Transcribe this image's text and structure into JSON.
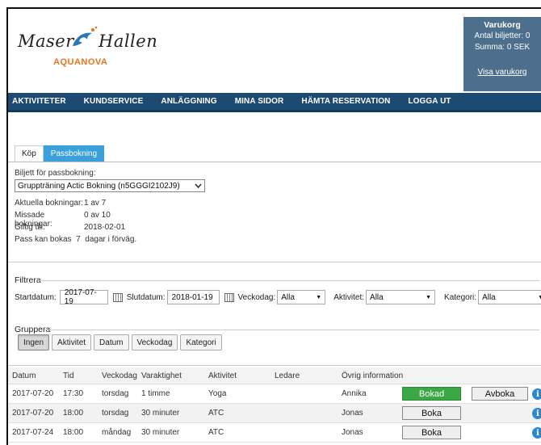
{
  "header": {
    "logo_word1": "Maser",
    "logo_word2": "Hallen",
    "logo_sub": "AQUANOVA",
    "cart": {
      "title": "Varukorg",
      "tickets": "Antal biljetter: 0",
      "sum": "Summa: 0 SEK",
      "link": "Visa varukorg"
    }
  },
  "nav": [
    "AKTIVITETER",
    "KUNDSERVICE",
    "ANLÄGGNING",
    "MINA SIDOR",
    "HÄMTA RESERVATION",
    "LOGGA UT"
  ],
  "tabs": [
    "Köp",
    "Passbokning"
  ],
  "booking": {
    "ticket_label": "Biljett för passbokning:",
    "ticket_value": "Gruppträning Actic Bokning (n5GGGI2102J9)",
    "current_label": "Aktuella bokningar:",
    "current_value": "1 av 7",
    "missed_label": "Missade bokningar:",
    "missed_value": "0 av 10",
    "valid_label": "Giltig till:",
    "valid_value": "2018-02-01",
    "note": "Pass kan bokas  7  dagar i förväg."
  },
  "filter": {
    "title": "Filtrera",
    "start_label": "Startdatum:",
    "start_value": "2017-07-19",
    "end_label": "Slutdatum:",
    "end_value": "2018-01-19",
    "weekday_label": "Veckodag:",
    "weekday_value": "Alla",
    "activity_label": "Aktivitet:",
    "activity_value": "Alla",
    "category_label": "Kategori:",
    "category_value": "Alla"
  },
  "group": {
    "title": "Gruppera",
    "buttons": [
      "Ingen",
      "Aktivitet",
      "Datum",
      "Veckodag",
      "Kategori"
    ]
  },
  "table": {
    "headers": [
      "Datum",
      "Tid",
      "Veckodag",
      "Varaktighet",
      "Aktivitet",
      "Ledare",
      "Övrig information"
    ],
    "rows": [
      {
        "date": "2017-07-20",
        "time": "17:30",
        "weekday": "torsdag",
        "duration": "1 timme",
        "activity": "Yoga",
        "leader": "Annika",
        "action": "Bokad",
        "cancel": "Avboka"
      },
      {
        "date": "2017-07-20",
        "time": "18:00",
        "weekday": "torsdag",
        "duration": "30 minuter",
        "activity": "ATC",
        "leader": "Jonas",
        "action": "Boka"
      },
      {
        "date": "2017-07-24",
        "time": "18:00",
        "weekday": "måndag",
        "duration": "30 minuter",
        "activity": "ATC",
        "leader": "Jonas",
        "action": "Boka"
      }
    ],
    "info_icon": "i"
  },
  "colors": {
    "nav": "#1c4a72",
    "cart": "#4d6f8e",
    "active_tab": "#3aa0db",
    "booked": "#39a845",
    "logo_orange": "#e8731a"
  }
}
